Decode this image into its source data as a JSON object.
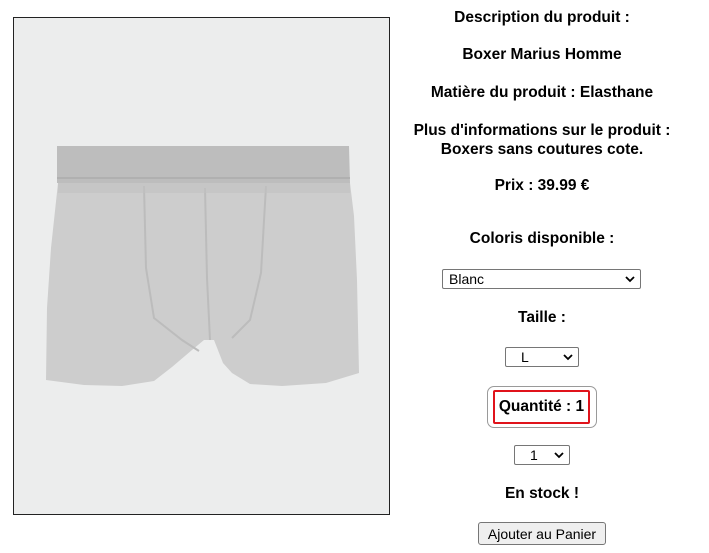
{
  "product": {
    "image_alt": "Boxer gris",
    "description_heading": "Description du produit :",
    "name": "Boxer Marius Homme",
    "material": "Matière du produit : Elasthane",
    "more_info_label": "Plus d'informations sur le produit :",
    "more_info_text": "Boxers sans coutures cote.",
    "price": "Prix : 39.99 €"
  },
  "options": {
    "color_label": "Coloris disponible :",
    "color_selected": "Blanc",
    "size_label": "Taille :",
    "size_selected": "L",
    "quantity_label": "Quantité : 1",
    "quantity_selected": "1",
    "stock_status": "En stock !",
    "add_to_cart_label": "Ajouter au Panier"
  },
  "icons": {
    "dropdown": "chevron-down-icon"
  },
  "colors": {
    "highlight_border": "#e0131b",
    "image_background": "#eceded"
  }
}
